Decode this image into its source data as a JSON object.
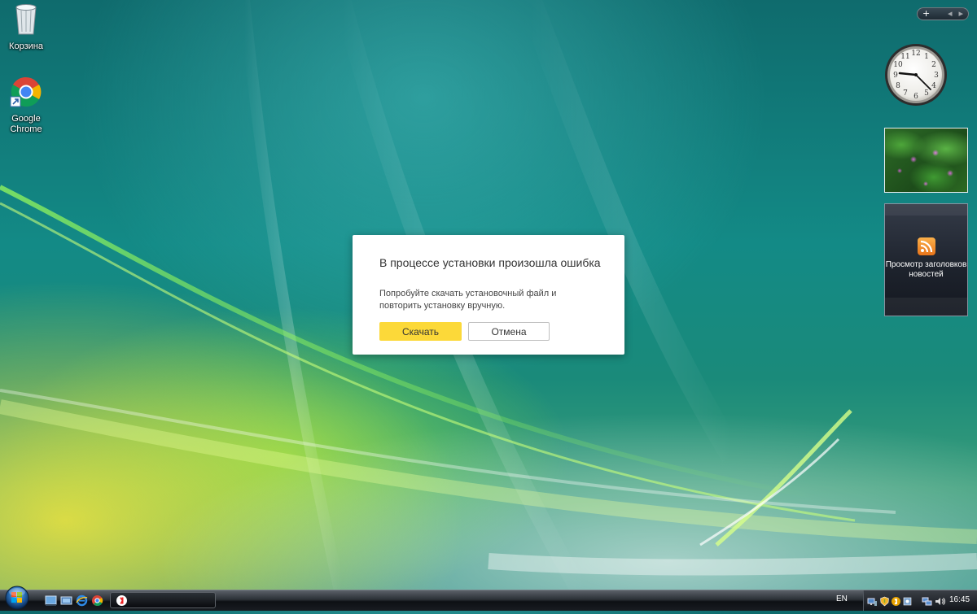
{
  "desktop": {
    "icons": [
      {
        "label": "Корзина",
        "icon": "recycle-bin-icon"
      },
      {
        "label": "Google Chrome",
        "icon": "chrome-icon"
      }
    ]
  },
  "gadgets": {
    "toolbar": {
      "add": "+",
      "prev": "◂",
      "next": "▸"
    },
    "clock": {
      "numbers": [
        "12",
        "1",
        "2",
        "3",
        "4",
        "5",
        "6",
        "7",
        "8",
        "9",
        "10",
        "11"
      ]
    },
    "news": {
      "label": "Просмотр заголовков новостей",
      "icon": "rss-icon"
    }
  },
  "dialog": {
    "title": "В процессе установки произошла ошибка",
    "message": "Попробуйте скачать установочный файл и повторить установку вручную.",
    "download_label": "Скачать",
    "cancel_label": "Отмена",
    "accent_color": "#fcd939"
  },
  "taskbar": {
    "quick_launch": [
      "show-desktop-icon",
      "switch-windows-icon",
      "internet-explorer-icon",
      "chrome-icon"
    ],
    "task_button": {
      "icon": "yandex-icon",
      "label": ""
    },
    "language": "EN",
    "time": "16:45"
  }
}
